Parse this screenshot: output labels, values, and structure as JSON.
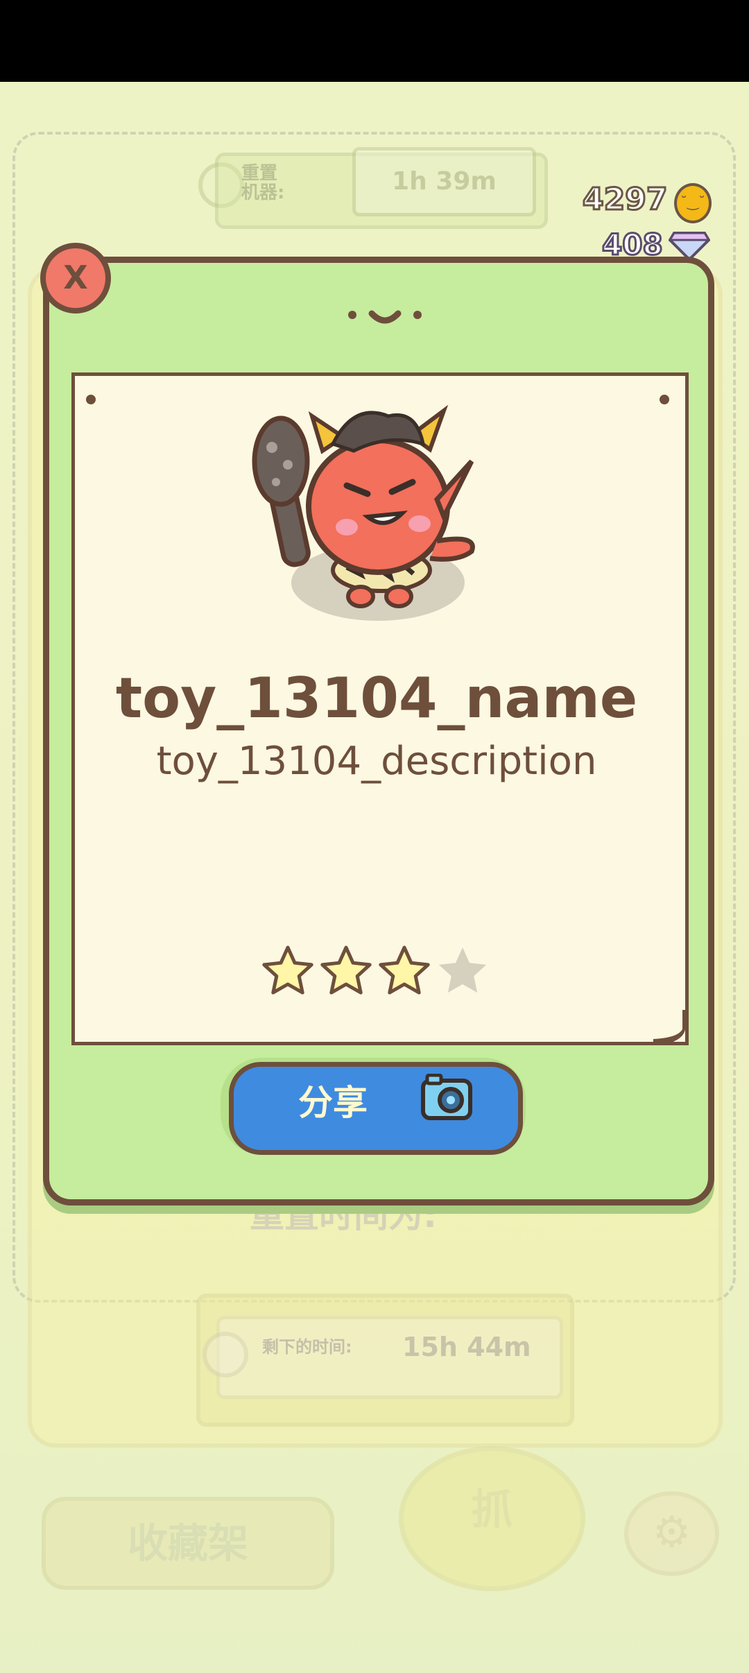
{
  "background_ui": {
    "reset_label": "重置\n机器:",
    "reset_timer": "1h 39m",
    "coins": "4297",
    "gems": "408",
    "reset_time_label": "重置时间为:",
    "remaining_label": "剩下的时间:",
    "remaining_value": "15h 44m",
    "collection_button": "收藏架",
    "grab_button": "抓"
  },
  "modal": {
    "close_label": "X",
    "toy_name": "toy_13104_name",
    "toy_description": "toy_13104_description",
    "stars_filled": 3,
    "stars_total": 4,
    "share_label": "分享"
  },
  "colors": {
    "modal_bg": "#c6ec9e",
    "outline": "#6e4f3c",
    "paper": "#fcf8e2",
    "share_blue": "#3f8be0",
    "close_red": "#f0796a",
    "star_fill": "#fff6a8",
    "star_empty": "#d6d0bf"
  }
}
